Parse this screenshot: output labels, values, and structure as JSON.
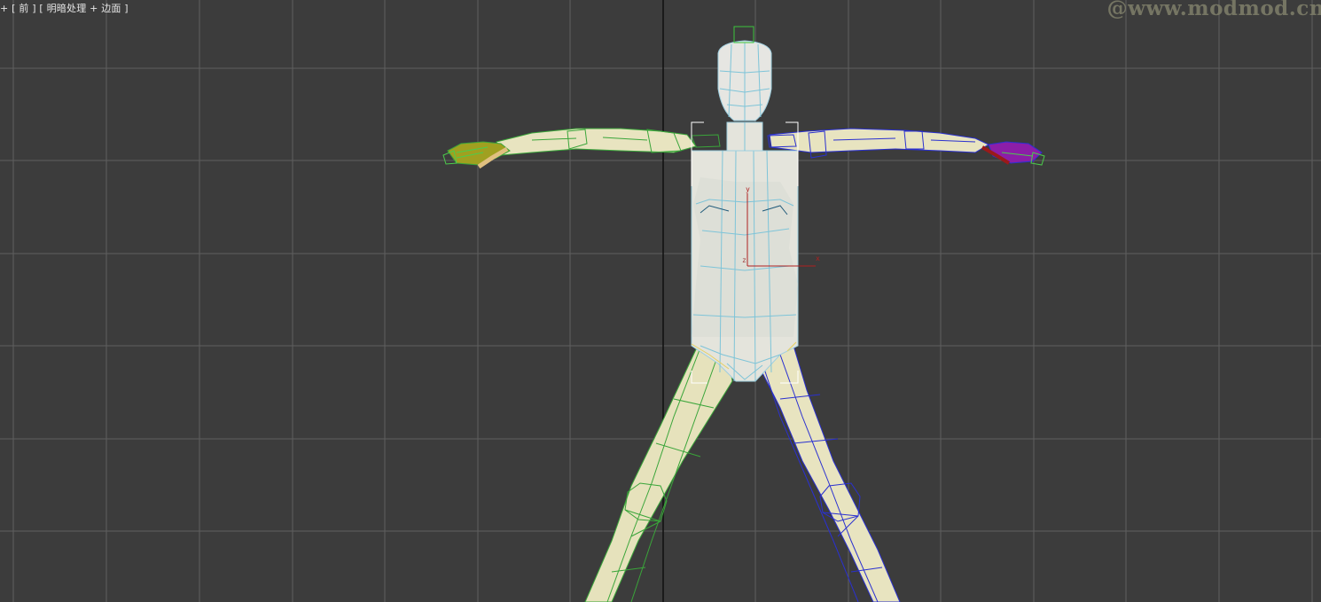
{
  "viewport": {
    "label_plus": "+",
    "label_name": "[ 前 ]",
    "label_shading": "[ 明暗处理 + 边面 ]"
  },
  "watermark": "@www.modmod.cn",
  "gizmo": {
    "x_label": "x",
    "y_label": "y",
    "z_label": "z"
  },
  "colors": {
    "background": "#3c3c3c",
    "grid": "#5e5e5e",
    "mesh_fill": "#e8e4c0",
    "left_bones": "#3cc43c",
    "right_bones": "#2a30d0",
    "selection": "#ffffff"
  }
}
